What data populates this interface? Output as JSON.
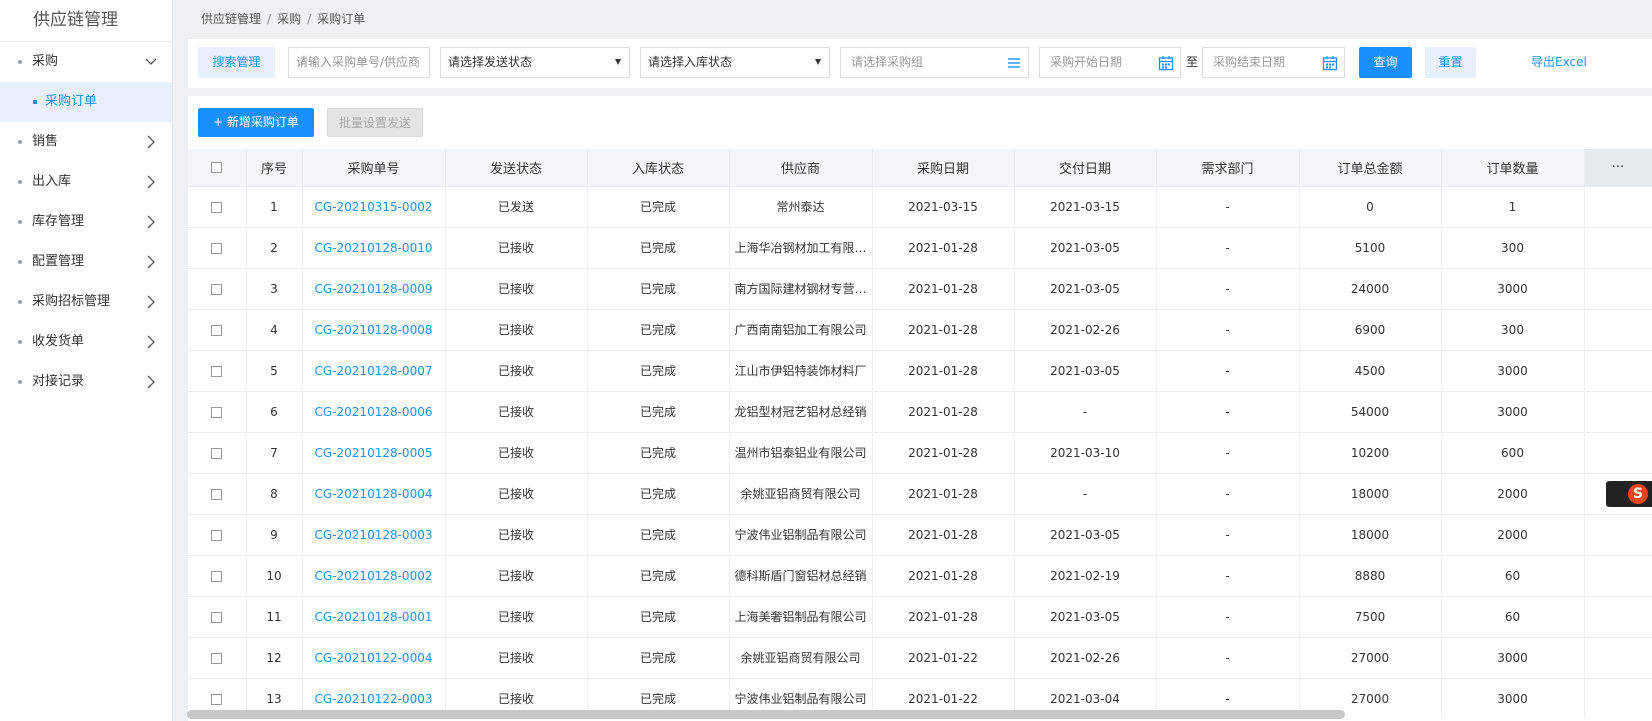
{
  "app": {
    "title": "供应链管理"
  },
  "sidebar": {
    "items": [
      {
        "label": "采购",
        "expanded": true
      },
      {
        "label": "销售"
      },
      {
        "label": "出入库"
      },
      {
        "label": "库存管理"
      },
      {
        "label": "配置管理"
      },
      {
        "label": "采购招标管理"
      },
      {
        "label": "收发货单"
      },
      {
        "label": "对接记录"
      }
    ],
    "active_sub": "采购订单"
  },
  "breadcrumb": [
    "供应链管理",
    "采购",
    "采购订单"
  ],
  "filters": {
    "search_mgmt_label": "搜索管理",
    "keyword_placeholder": "请输入采购单号/供应商",
    "send_status_placeholder": "请选择发送状态",
    "stock_status_placeholder": "请选择入库状态",
    "group_placeholder": "请选择采购组",
    "start_date_placeholder": "采购开始日期",
    "to_label": "至",
    "end_date_placeholder": "采购结束日期",
    "query_label": "查询",
    "reset_label": "重置",
    "export_label": "导出Excel"
  },
  "actions": {
    "add_label": "+ 新增采购订单",
    "batch_label": "批量设置发送"
  },
  "table": {
    "headers": [
      "序号",
      "采购单号",
      "发送状态",
      "入库状态",
      "供应商",
      "采购日期",
      "交付日期",
      "需求部门",
      "订单总金额",
      "订单数量"
    ],
    "more_label": "···",
    "rows": [
      [
        "1",
        "CG-20210315-0002",
        "已发送",
        "已完成",
        "常州泰达",
        "2021-03-15",
        "2021-03-15",
        "-",
        "0",
        "1"
      ],
      [
        "2",
        "CG-20210128-0010",
        "已接收",
        "已完成",
        "上海华冶钢材加工有限…",
        "2021-01-28",
        "2021-03-05",
        "-",
        "5100",
        "300"
      ],
      [
        "3",
        "CG-20210128-0009",
        "已接收",
        "已完成",
        "南方国际建材钢材专营…",
        "2021-01-28",
        "2021-03-05",
        "-",
        "24000",
        "3000"
      ],
      [
        "4",
        "CG-20210128-0008",
        "已接收",
        "已完成",
        "广西南南铝加工有限公司",
        "2021-01-28",
        "2021-02-26",
        "-",
        "6900",
        "300"
      ],
      [
        "5",
        "CG-20210128-0007",
        "已接收",
        "已完成",
        "江山市伊铝特装饰材料厂",
        "2021-01-28",
        "2021-03-05",
        "-",
        "4500",
        "3000"
      ],
      [
        "6",
        "CG-20210128-0006",
        "已接收",
        "已完成",
        "龙铝型材冠艺铝材总经销",
        "2021-01-28",
        "-",
        "-",
        "54000",
        "3000"
      ],
      [
        "7",
        "CG-20210128-0005",
        "已接收",
        "已完成",
        "温州市铝泰铝业有限公司",
        "2021-01-28",
        "2021-03-10",
        "-",
        "10200",
        "600"
      ],
      [
        "8",
        "CG-20210128-0004",
        "已接收",
        "已完成",
        "余姚亚铝商贸有限公司",
        "2021-01-28",
        "-",
        "-",
        "18000",
        "2000"
      ],
      [
        "9",
        "CG-20210128-0003",
        "已接收",
        "已完成",
        "宁波伟业铝制品有限公司",
        "2021-01-28",
        "2021-03-05",
        "-",
        "18000",
        "2000"
      ],
      [
        "10",
        "CG-20210128-0002",
        "已接收",
        "已完成",
        "德科斯盾门窗铝材总经销",
        "2021-01-28",
        "2021-02-19",
        "-",
        "8880",
        "60"
      ],
      [
        "11",
        "CG-20210128-0001",
        "已接收",
        "已完成",
        "上海美奢铝制品有限公司",
        "2021-01-28",
        "2021-03-05",
        "-",
        "7500",
        "60"
      ],
      [
        "12",
        "CG-20210122-0004",
        "已接收",
        "已完成",
        "余姚亚铝商贸有限公司",
        "2021-01-22",
        "2021-02-26",
        "-",
        "27000",
        "3000"
      ],
      [
        "13",
        "CG-20210122-0003",
        "已接收",
        "已完成",
        "宁波伟业铝制品有限公司",
        "2021-01-22",
        "2021-03-04",
        "-",
        "27000",
        "3000"
      ]
    ]
  },
  "colors": {
    "primary": "#1890ff",
    "sidebar_active_bg": "#e8f1fb"
  },
  "icons": {
    "calendar": "calendar-icon",
    "list": "list-icon",
    "chevron": "chevron-right-icon"
  }
}
